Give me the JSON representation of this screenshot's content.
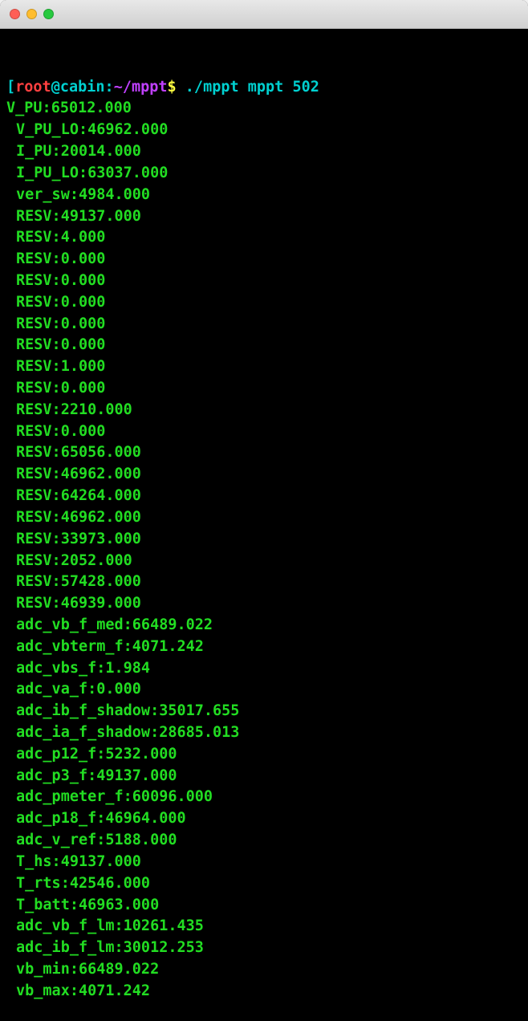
{
  "prompt": {
    "open_bracket": "[",
    "user": "root",
    "at": "@",
    "host": "cabin",
    "colon": ":",
    "path": "~/mppt",
    "close_bracket": "",
    "dollar": "$ ",
    "command": "./mppt mppt 502"
  },
  "lines": [
    {
      "indent": false,
      "text": "V_PU:65012.000"
    },
    {
      "indent": true,
      "text": "V_PU_LO:46962.000"
    },
    {
      "indent": true,
      "text": "I_PU:20014.000"
    },
    {
      "indent": true,
      "text": "I_PU_LO:63037.000"
    },
    {
      "indent": true,
      "text": "ver_sw:4984.000"
    },
    {
      "indent": true,
      "text": "RESV:49137.000"
    },
    {
      "indent": true,
      "text": "RESV:4.000"
    },
    {
      "indent": true,
      "text": "RESV:0.000"
    },
    {
      "indent": true,
      "text": "RESV:0.000"
    },
    {
      "indent": true,
      "text": "RESV:0.000"
    },
    {
      "indent": true,
      "text": "RESV:0.000"
    },
    {
      "indent": true,
      "text": "RESV:0.000"
    },
    {
      "indent": true,
      "text": "RESV:1.000"
    },
    {
      "indent": true,
      "text": "RESV:0.000"
    },
    {
      "indent": true,
      "text": "RESV:2210.000"
    },
    {
      "indent": true,
      "text": "RESV:0.000"
    },
    {
      "indent": true,
      "text": "RESV:65056.000"
    },
    {
      "indent": true,
      "text": "RESV:46962.000"
    },
    {
      "indent": true,
      "text": "RESV:64264.000"
    },
    {
      "indent": true,
      "text": "RESV:46962.000"
    },
    {
      "indent": true,
      "text": "RESV:33973.000"
    },
    {
      "indent": true,
      "text": "RESV:2052.000"
    },
    {
      "indent": true,
      "text": "RESV:57428.000"
    },
    {
      "indent": true,
      "text": "RESV:46939.000"
    },
    {
      "indent": true,
      "text": "adc_vb_f_med:66489.022"
    },
    {
      "indent": true,
      "text": "adc_vbterm_f:4071.242"
    },
    {
      "indent": true,
      "text": "adc_vbs_f:1.984"
    },
    {
      "indent": true,
      "text": "adc_va_f:0.000"
    },
    {
      "indent": true,
      "text": "adc_ib_f_shadow:35017.655"
    },
    {
      "indent": true,
      "text": "adc_ia_f_shadow:28685.013"
    },
    {
      "indent": true,
      "text": "adc_p12_f:5232.000"
    },
    {
      "indent": true,
      "text": "adc_p3_f:49137.000"
    },
    {
      "indent": true,
      "text": "adc_pmeter_f:60096.000"
    },
    {
      "indent": true,
      "text": "adc_p18_f:46964.000"
    },
    {
      "indent": true,
      "text": "adc_v_ref:5188.000"
    },
    {
      "indent": true,
      "text": "T_hs:49137.000"
    },
    {
      "indent": true,
      "text": "T_rts:42546.000"
    },
    {
      "indent": true,
      "text": "T_batt:46963.000"
    },
    {
      "indent": true,
      "text": "adc_vb_f_lm:10261.435"
    },
    {
      "indent": true,
      "text": "adc_ib_f_lm:30012.253"
    },
    {
      "indent": true,
      "text": "vb_min:66489.022"
    },
    {
      "indent": true,
      "text": "vb_max:4071.242"
    }
  ]
}
